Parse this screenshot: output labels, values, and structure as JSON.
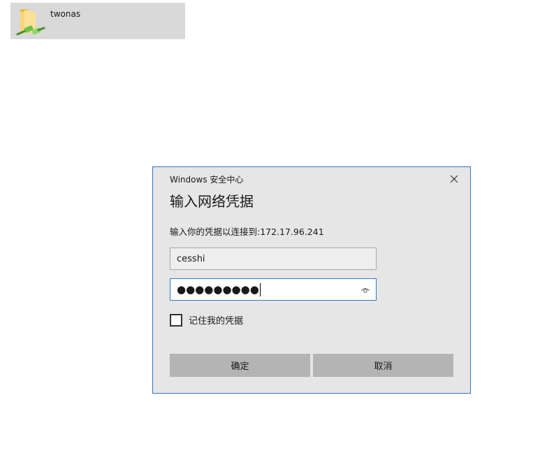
{
  "explorer": {
    "folder_item": {
      "label": "twonas",
      "icon": "network-folder-icon"
    }
  },
  "dialog": {
    "caption": "Windows 安全中心",
    "title": "输入网络凭据",
    "subtitle": "输入你的凭据以连接到:172.17.96.241",
    "username_value": "cesshi",
    "password_masked": "●●●●●●●●●",
    "remember_label": "记住我的凭据",
    "remember_checked": false,
    "ok_label": "确定",
    "cancel_label": "取消",
    "icons": {
      "close": "close-icon",
      "reveal": "reveal-password-icon"
    }
  },
  "colors": {
    "dialog_bg": "#e6e6e6",
    "accent_border": "#2b78c8",
    "button_bg": "#b4b4b4",
    "selection_bg": "#d9d9d9"
  }
}
